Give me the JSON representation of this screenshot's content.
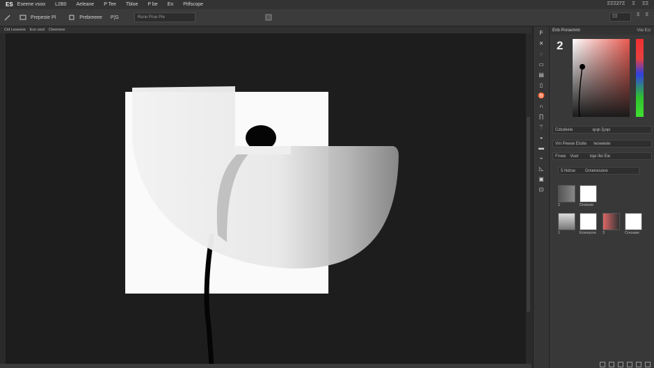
{
  "menubar": {
    "logo": "ES",
    "items": [
      "Eseene vsoo",
      "L2B0",
      "Aeleane",
      "P Tee",
      "Tbloe",
      "P be",
      "Eo",
      "Pitfscope"
    ],
    "right": [
      "ΞΞΞ27Ξ",
      "Ξ",
      "ΞΞ"
    ]
  },
  "options_bar": {
    "items": [
      "Prepeste Pl",
      "Prebreeee",
      "P¦G"
    ],
    "field_text": "Rune Prue Pie",
    "right_items": [
      "ΞΞ",
      "Ξ",
      "Ξ"
    ]
  },
  "tabs": [
    "Cid Leseene",
    "Ecn eesl",
    "Cleeneoe"
  ],
  "panel": {
    "header_title": "Enb Pnroemmi",
    "header_right": "Viw Eci",
    "big_number": "2",
    "row1_label": "Cdsdeeie",
    "row1_value": "ιιρφι ξιρφι",
    "row2_label": "Vrn Peeee Etoite",
    "row2_value": "Ieoeeieie",
    "row3_tabs": [
      "Frvee",
      "Vuer"
    ],
    "row3_value": "Ieje ifei Eie",
    "layer_num": "5",
    "layer_label": "Ndrse",
    "layer_value": "Gmenesone",
    "swatch_labels": [
      "2",
      "Dmleeie",
      "1",
      "Eoesssse",
      "3",
      "Cresaae"
    ]
  },
  "colors": {
    "accent": "#e85a50",
    "canvas_bg": "#1d1d1d",
    "ui_bg": "#383838"
  }
}
